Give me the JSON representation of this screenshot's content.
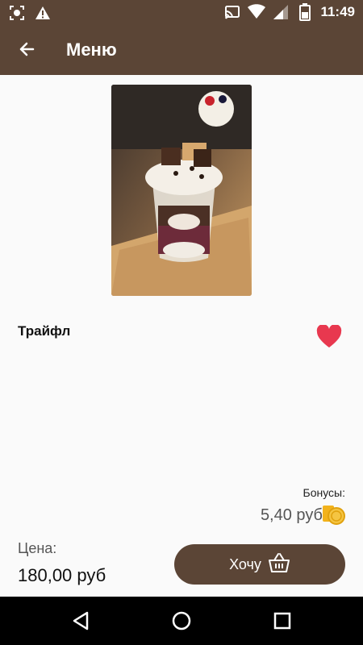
{
  "status_bar": {
    "time": "11:49",
    "left_icons": [
      "screenshot-icon",
      "warning-icon"
    ],
    "right_icons": [
      "cast-icon",
      "wifi-icon",
      "signal-icon",
      "battery-icon"
    ]
  },
  "toolbar": {
    "title": "Меню",
    "back_icon": "arrow-left-icon"
  },
  "product": {
    "name": "Трайфл",
    "image_alt_icon": "dessert-photo",
    "favorite_icon": "heart-icon",
    "favorite_color": "#e8384f"
  },
  "bonus": {
    "label": "Бонусы:",
    "value": "5,40 руб",
    "icon": "coin-icon"
  },
  "price": {
    "label": "Цена:",
    "value": "180,00 руб"
  },
  "actions": {
    "want_label": "Хочу",
    "want_icon": "basket-icon"
  },
  "nav_bar": {
    "buttons": [
      "back-triangle-icon",
      "home-circle-icon",
      "recents-square-icon"
    ]
  },
  "colors": {
    "brand": "#5b4536",
    "accent_heart": "#e8384f",
    "coin": "#f2b21b"
  }
}
